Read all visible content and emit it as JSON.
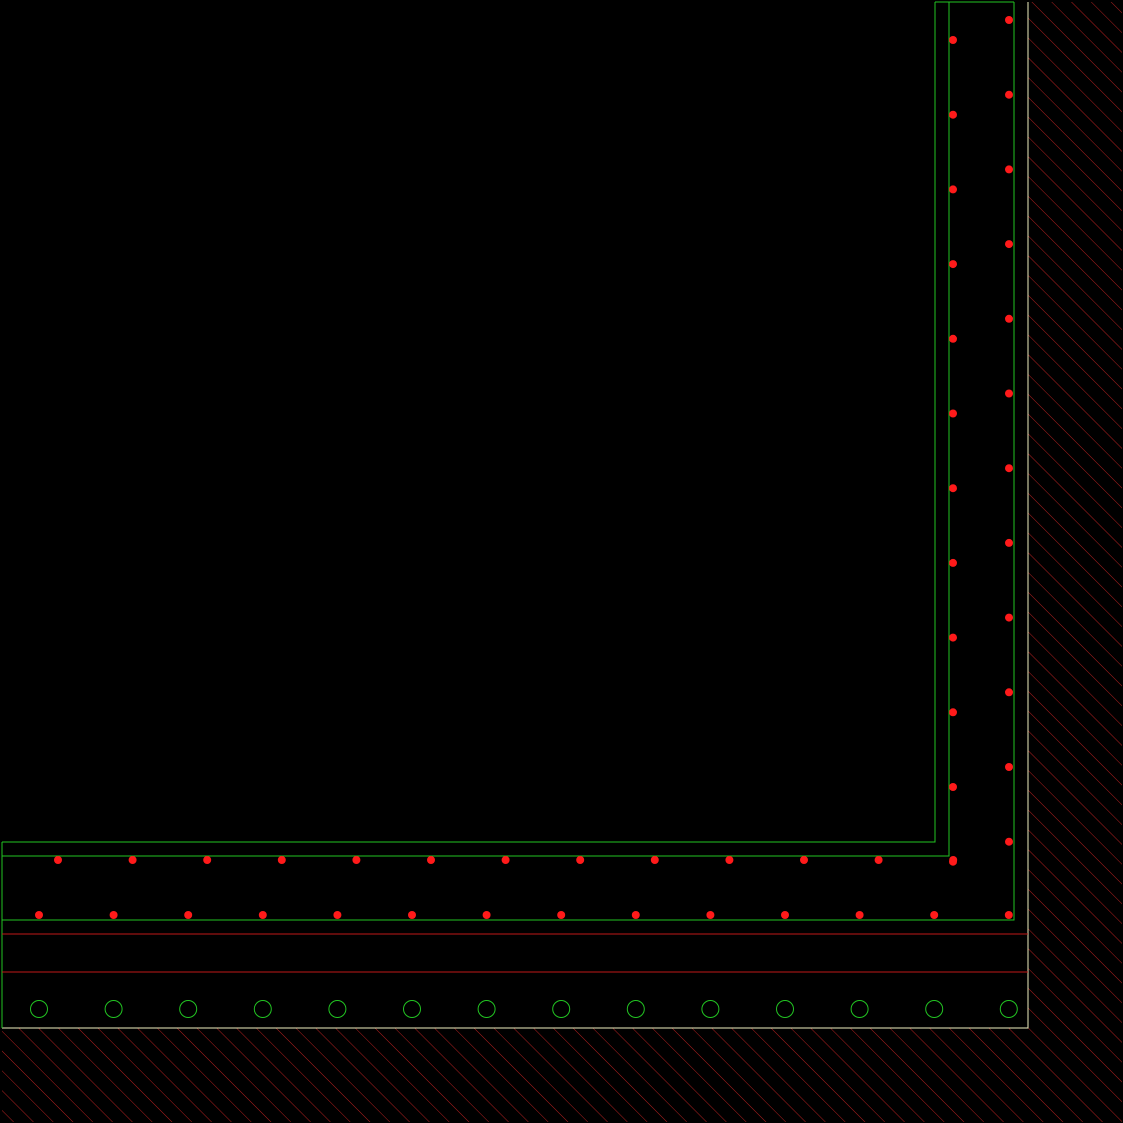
{
  "drawing": {
    "description_visible_text": "",
    "colors": {
      "background": "#000000",
      "wall_outline": "#22c422",
      "reinforcement_dot": "#ff1a1a",
      "hatch": "#b02020",
      "soil_outline": "#f0f0c0",
      "membrane_line": "#c01818",
      "pile_circle": "#22c422"
    },
    "icons": {
      "rebar": "filled-red-dot",
      "pile": "green-circle",
      "soil": "diagonal-hatch"
    },
    "counts": {
      "vertical_inner_rebars": 12,
      "vertical_outer_rebars": 12,
      "horizontal_inner_rebars": 13,
      "horizontal_outer_rebars": 14,
      "piles": 14
    }
  }
}
